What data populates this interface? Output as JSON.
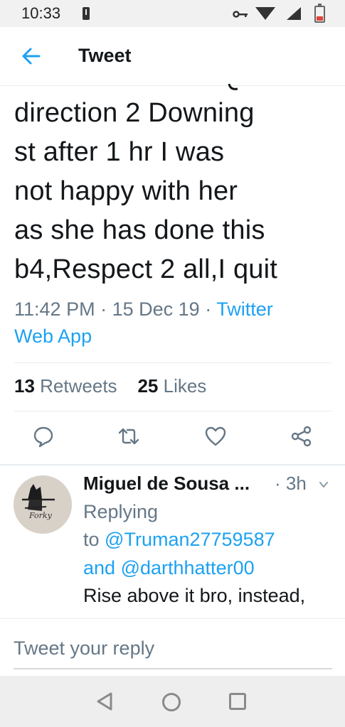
{
  "status_bar": {
    "time": "10:33",
    "icons": [
      "alert-icon",
      "key-icon",
      "wifi-icon",
      "signal-icon",
      "battery-icon"
    ]
  },
  "header": {
    "title": "Tweet",
    "back_icon": "arrow-left-icon"
  },
  "tweet": {
    "lines": [
      "direction 2 Downing",
      "st after 1 hr I was",
      "not happy with her",
      "as she has done this",
      "b4,Respect 2 all,I quit"
    ],
    "time": "11:42 PM",
    "separator": "·",
    "date": "15 Dec 19",
    "source_line1": "Twitter",
    "source_line2": "Web App",
    "retweets_count": "13",
    "retweets_label": "Retweets",
    "likes_count": "25",
    "likes_label": "Likes",
    "actions": [
      "reply-icon",
      "retweet-icon",
      "like-icon",
      "share-icon"
    ]
  },
  "reply": {
    "author": "Miguel de Sousa ...",
    "time": "· 3h",
    "replying_label": "Replying",
    "to_label": "to",
    "mention1": "@Truman27759587",
    "and_label": "and",
    "mention2": "@darthhatter00",
    "text": "Rise above it bro, instead,",
    "text_cut": "... ...",
    "avatar_text": "Forky"
  },
  "compose": {
    "placeholder": "Tweet your reply"
  },
  "colors": {
    "accent": "#1da1f2",
    "secondary_text": "#657786",
    "primary_text": "#14171a"
  }
}
